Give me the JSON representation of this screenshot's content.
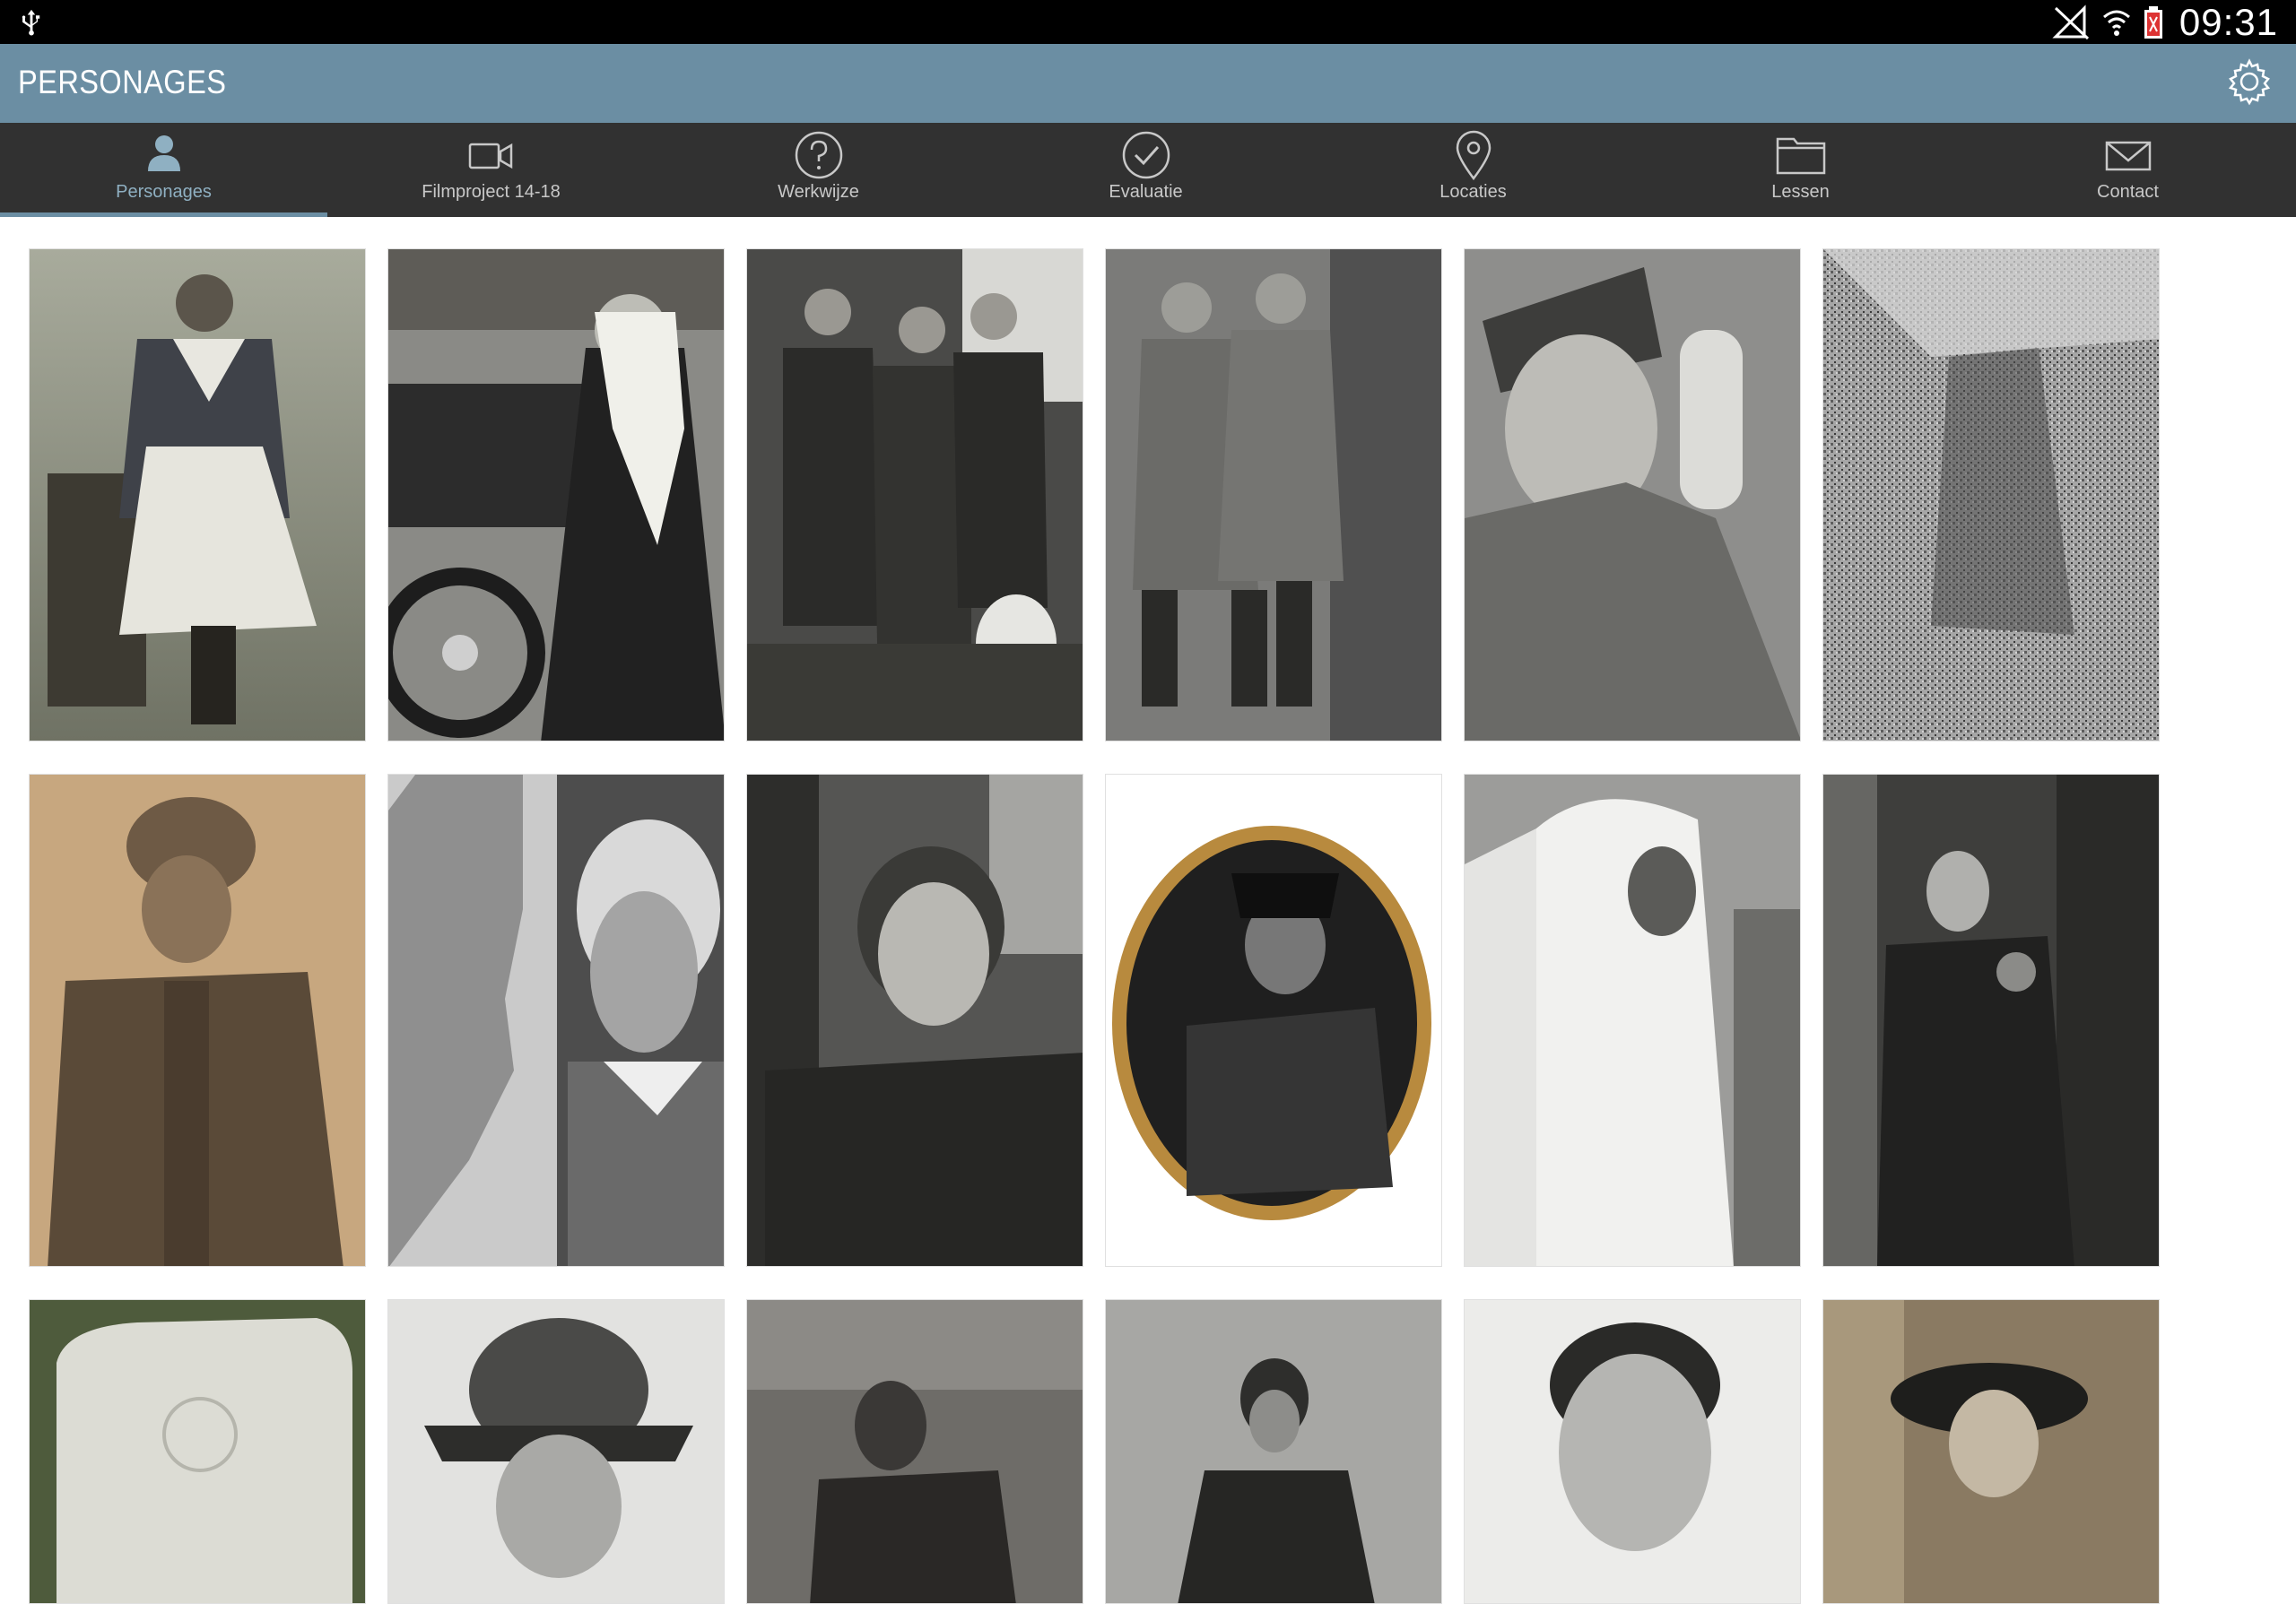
{
  "status_bar": {
    "time": "09:31",
    "icons": [
      "usb-icon",
      "no-signal-icon",
      "wifi-icon",
      "battery-low-icon"
    ]
  },
  "header": {
    "title": "PERSONAGES",
    "settings_icon": "gear-icon"
  },
  "tabs": [
    {
      "label": "Personages",
      "icon": "person-icon",
      "active": true
    },
    {
      "label": "Filmproject 14-18",
      "icon": "video-camera-icon",
      "active": false
    },
    {
      "label": "Werkwijze",
      "icon": "question-circle-icon",
      "active": false
    },
    {
      "label": "Evaluatie",
      "icon": "check-circle-icon",
      "active": false
    },
    {
      "label": "Locaties",
      "icon": "map-pin-icon",
      "active": false
    },
    {
      "label": "Lessen",
      "icon": "folder-icon",
      "active": false
    },
    {
      "label": "Contact",
      "icon": "envelope-icon",
      "active": false
    }
  ],
  "colors": {
    "action_bar": "#6b8ea3",
    "tab_bar": "#313131",
    "active_indicator": "#6b8ea3"
  }
}
